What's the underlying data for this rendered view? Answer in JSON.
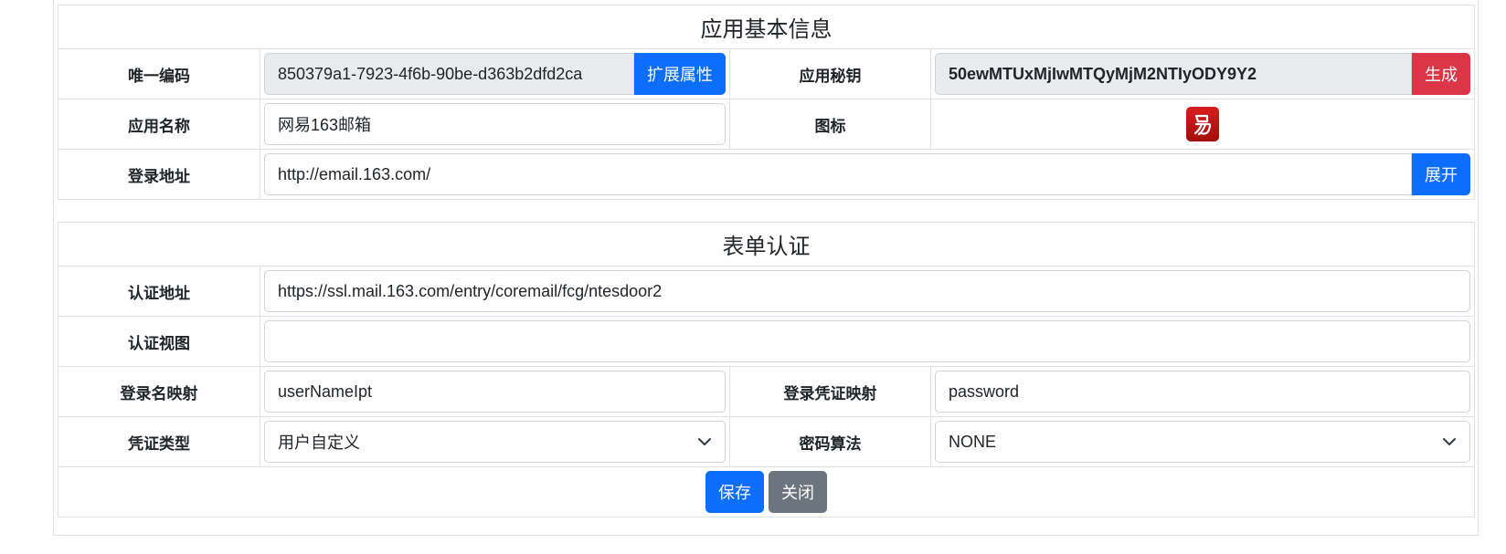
{
  "section1": {
    "title": "应用基本信息",
    "unique_code": {
      "label": "唯一编码",
      "value": "850379a1-7923-4f6b-90be-d363b2dfd2ca",
      "button": "扩展属性"
    },
    "app_secret": {
      "label": "应用秘钥",
      "value": "50ewMTUxMjIwMTQyMjM2NTIyODY9Y2",
      "button": "生成"
    },
    "app_name": {
      "label": "应用名称",
      "value": "网易163邮箱"
    },
    "icon": {
      "label": "图标",
      "icon_name": "netease-logo-icon",
      "color": "#c8161d"
    },
    "login_url": {
      "label": "登录地址",
      "value": "http://email.163.com/",
      "button": "展开"
    }
  },
  "section2": {
    "title": "表单认证",
    "auth_url": {
      "label": "认证地址",
      "value": "https://ssl.mail.163.com/entry/coremail/fcg/ntesdoor2"
    },
    "auth_view": {
      "label": "认证视图",
      "value": ""
    },
    "login_name_map": {
      "label": "登录名映射",
      "value": "userNameIpt"
    },
    "credential_map": {
      "label": "登录凭证映射",
      "value": "password"
    },
    "credential_type": {
      "label": "凭证类型",
      "value": "用户自定义"
    },
    "password_algo": {
      "label": "密码算法",
      "value": "NONE"
    }
  },
  "actions": {
    "save": "保存",
    "close": "关闭"
  },
  "colors": {
    "primary": "#0d6efd",
    "danger": "#dc3545",
    "secondary": "#6c757d"
  }
}
